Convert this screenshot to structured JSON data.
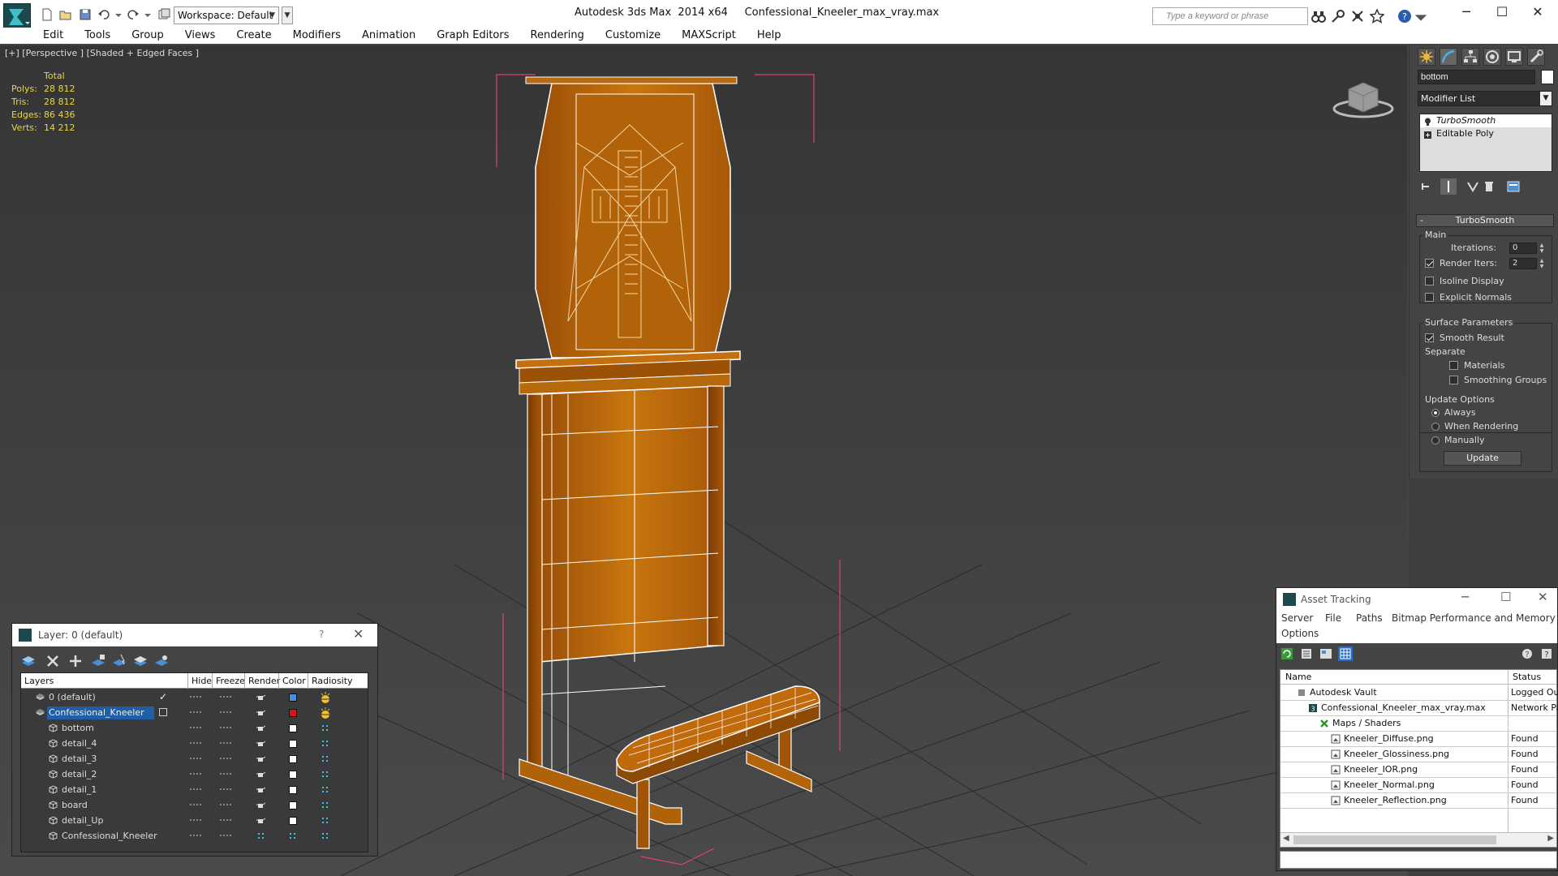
{
  "titlebar": {
    "workspace": "Workspace: Default",
    "app_name": "Autodesk 3ds Max  2014 x64",
    "file_name": "Confessional_Kneeler_max_vray.max",
    "search_placeholder": "Type a keyword or phrase"
  },
  "menu": [
    "Edit",
    "Tools",
    "Group",
    "Views",
    "Create",
    "Modifiers",
    "Animation",
    "Graph Editors",
    "Rendering",
    "Customize",
    "MAXScript",
    "Help"
  ],
  "viewport": {
    "label": "[+] [Perspective ] [Shaded + Edged Faces ]",
    "stats_header": "Total",
    "stats": [
      {
        "key": "Polys:",
        "value": "28 812"
      },
      {
        "key": "Tris:",
        "value": "28 812"
      },
      {
        "key": "Edges:",
        "value": "86 436"
      },
      {
        "key": "Verts:",
        "value": "14 212"
      }
    ],
    "colors": {
      "wood": "#b8640c",
      "wireframe": "#ffffff",
      "bbox": "#e0407a",
      "grid": "#1e1e1e"
    }
  },
  "command_panel": {
    "object_name": "bottom",
    "modifier_list": "Modifier List",
    "stack": [
      "TurboSmooth",
      "Editable Poly"
    ],
    "turbosmooth": {
      "title": "TurboSmooth",
      "main_label": "Main",
      "iterations_label": "Iterations:",
      "iterations": "0",
      "render_iters_label": "Render Iters:",
      "render_iters": "2",
      "render_iters_checked": true,
      "isoline_label": "Isoline Display",
      "explicit_normals_label": "Explicit Normals",
      "surface_params_label": "Surface Parameters",
      "smooth_result_label": "Smooth Result",
      "separate_label": "Separate",
      "materials_label": "Materials",
      "smoothing_groups_label": "Smoothing Groups",
      "update_options_label": "Update Options",
      "always_label": "Always",
      "when_rendering_label": "When Rendering",
      "manually_label": "Manually",
      "update_button": "Update"
    }
  },
  "layer_dialog": {
    "title": "Layer: 0 (default)",
    "help": "?",
    "columns": [
      "Layers",
      "Hide",
      "Freeze",
      "Render",
      "Color",
      "Radiosity"
    ],
    "rows": [
      {
        "name": "0 (default)",
        "level": 0,
        "color": "#4a8fd8",
        "selected": false,
        "current": true
      },
      {
        "name": "Confessional_Kneeler",
        "level": 0,
        "color": "#d01818",
        "selected": true,
        "current": false
      },
      {
        "name": "bottom",
        "level": 1,
        "color": "#ffffff"
      },
      {
        "name": "detail_4",
        "level": 1,
        "color": "#ffffff"
      },
      {
        "name": "detail_3",
        "level": 1,
        "color": "#ffffff"
      },
      {
        "name": "detail_2",
        "level": 1,
        "color": "#ffffff"
      },
      {
        "name": "detail_1",
        "level": 1,
        "color": "#ffffff"
      },
      {
        "name": "board",
        "level": 1,
        "color": "#ffffff"
      },
      {
        "name": "detail_Up",
        "level": 1,
        "color": "#ffffff"
      },
      {
        "name": "Confessional_Kneeler",
        "level": 1,
        "color": "#ffffff"
      }
    ]
  },
  "asset_tracking": {
    "title": "Asset Tracking",
    "menu": [
      "Server",
      "File",
      "Paths",
      "Bitmap Performance and Memory",
      "Options"
    ],
    "columns": [
      "Name",
      "Status"
    ],
    "rows": [
      {
        "name": "Autodesk Vault",
        "status": "Logged Out",
        "level": 1
      },
      {
        "name": "Confessional_Kneeler_max_vray.max",
        "status": "Network Path",
        "level": 2
      },
      {
        "name": "Maps / Shaders",
        "status": "",
        "level": 3
      },
      {
        "name": "Kneeler_Diffuse.png",
        "status": "Found",
        "level": 4
      },
      {
        "name": "Kneeler_Glossiness.png",
        "status": "Found",
        "level": 4
      },
      {
        "name": "Kneeler_IOR.png",
        "status": "Found",
        "level": 4
      },
      {
        "name": "Kneeler_Normal.png",
        "status": "Found",
        "level": 4
      },
      {
        "name": "Kneeler_Reflection.png",
        "status": "Found",
        "level": 4
      }
    ]
  }
}
